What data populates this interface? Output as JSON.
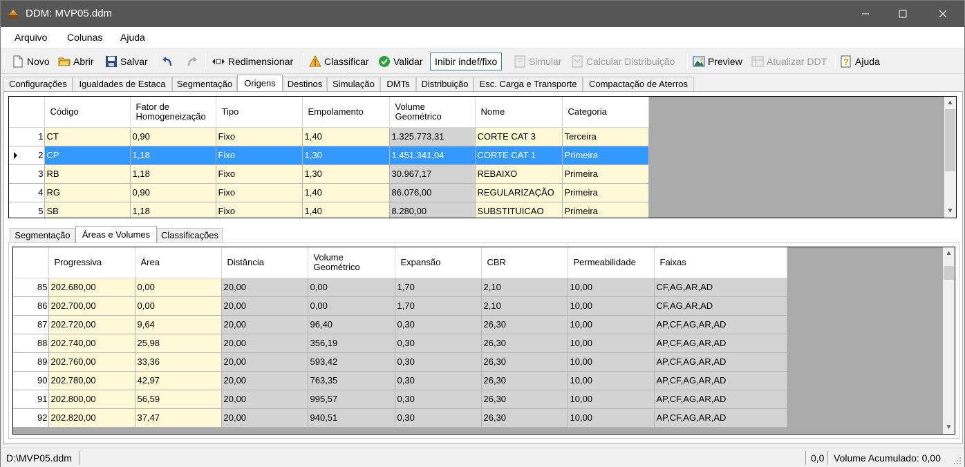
{
  "window": {
    "title": "DDM: MVP05.ddm",
    "minimize_icon": "minimize-icon",
    "maximize_icon": "maximize-icon",
    "close_icon": "close-icon"
  },
  "menu": [
    "Arquivo",
    "Colunas",
    "Ajuda"
  ],
  "toolbar": {
    "novo": "Novo",
    "abrir": "Abrir",
    "salvar": "Salvar",
    "redimensionar": "Redimensionar",
    "classificar": "Classificar",
    "validar": "Validar",
    "inibir": "Inibir indef/fixo",
    "simular": "Simular",
    "calcular": "Calcular Distribuição",
    "preview": "Preview",
    "atualizar": "Atualizar DDT",
    "ajuda": "Ajuda"
  },
  "main_tabs": [
    "Configurações",
    "Igualdades de Estaca",
    "Segmentação",
    "Origens",
    "Destinos",
    "Simulação",
    "DMTs",
    "Distribuição",
    "Esc. Carga e Transporte",
    "Compactação de Aterros"
  ],
  "main_active_tab": "Origens",
  "origens_grid": {
    "columns": [
      "Código",
      "Fator de Homogeneização",
      "Tipo",
      "Empolamento",
      "Volume Geométrico",
      "Nome",
      "Categoria"
    ],
    "rows": [
      {
        "n": "1",
        "codigo": "CT",
        "fator": "0,90",
        "tipo": "Fixo",
        "empolamento": "1,40",
        "volume": "1.325.773,31",
        "nome": "CORTE CAT 3",
        "categoria": "Terceira"
      },
      {
        "n": "2",
        "codigo": "CP",
        "fator": "1,18",
        "tipo": "Fixo",
        "empolamento": "1,30",
        "volume": "1.451.341,04",
        "nome": "CORTE CAT 1",
        "categoria": "Primeira"
      },
      {
        "n": "3",
        "codigo": "RB",
        "fator": "1,18",
        "tipo": "Fixo",
        "empolamento": "1,30",
        "volume": "30.967,17",
        "nome": "REBAIXO",
        "categoria": "Primeira"
      },
      {
        "n": "4",
        "codigo": "RG",
        "fator": "0,90",
        "tipo": "Fixo",
        "empolamento": "1,40",
        "volume": "86.076,00",
        "nome": "REGULARIZAÇÃO",
        "categoria": "Primeira"
      },
      {
        "n": "5",
        "codigo": "SB",
        "fator": "1,18",
        "tipo": "Fixo",
        "empolamento": "1,40",
        "volume": "8.280,00",
        "nome": "SUBSTITUICAO",
        "categoria": "Primeira"
      }
    ],
    "selected_row": "2"
  },
  "sub_tabs": [
    "Segmentação",
    "Áreas e Volumes",
    "Classificações"
  ],
  "sub_active_tab": "Áreas e Volumes",
  "areas_grid": {
    "columns": [
      "Progressiva",
      "Área",
      "Distância",
      "Volume Geométrico",
      "Expansão",
      "CBR",
      "Permeabilidade",
      "Faixas"
    ],
    "rows": [
      {
        "n": "85",
        "prog": "202.680,00",
        "area": "0,00",
        "dist": "20,00",
        "vol": "0,00",
        "exp": "1,70",
        "cbr": "2,10",
        "perm": "10,00",
        "faixas": "CF,AG,AR,AD"
      },
      {
        "n": "86",
        "prog": "202.700,00",
        "area": "0,00",
        "dist": "20,00",
        "vol": "0,00",
        "exp": "1,70",
        "cbr": "2,10",
        "perm": "10,00",
        "faixas": "CF,AG,AR,AD"
      },
      {
        "n": "87",
        "prog": "202.720,00",
        "area": "9,64",
        "dist": "20,00",
        "vol": "96,40",
        "exp": "0,30",
        "cbr": "26,30",
        "perm": "10,00",
        "faixas": "AP,CF,AG,AR,AD"
      },
      {
        "n": "88",
        "prog": "202.740,00",
        "area": "25,98",
        "dist": "20,00",
        "vol": "356,19",
        "exp": "0,30",
        "cbr": "26,30",
        "perm": "10,00",
        "faixas": "AP,CF,AG,AR,AD"
      },
      {
        "n": "89",
        "prog": "202.760,00",
        "area": "33,36",
        "dist": "20,00",
        "vol": "593,42",
        "exp": "0,30",
        "cbr": "26,30",
        "perm": "10,00",
        "faixas": "AP,CF,AG,AR,AD"
      },
      {
        "n": "90",
        "prog": "202.780,00",
        "area": "42,97",
        "dist": "20,00",
        "vol": "763,35",
        "exp": "0,30",
        "cbr": "26,30",
        "perm": "10,00",
        "faixas": "AP,CF,AG,AR,AD"
      },
      {
        "n": "91",
        "prog": "202.800,00",
        "area": "56,59",
        "dist": "20,00",
        "vol": "995,57",
        "exp": "0,30",
        "cbr": "26,30",
        "perm": "10,00",
        "faixas": "AP,CF,AG,AR,AD"
      },
      {
        "n": "92",
        "prog": "202.820,00",
        "area": "37,47",
        "dist": "20,00",
        "vol": "940,51",
        "exp": "0,30",
        "cbr": "26,30",
        "perm": "10,00",
        "faixas": "AP,CF,AG,AR,AD"
      }
    ]
  },
  "status": {
    "file": "D:\\MVP05.ddm",
    "value": "0,0",
    "volume": "Volume Acumulado: 0,00"
  }
}
